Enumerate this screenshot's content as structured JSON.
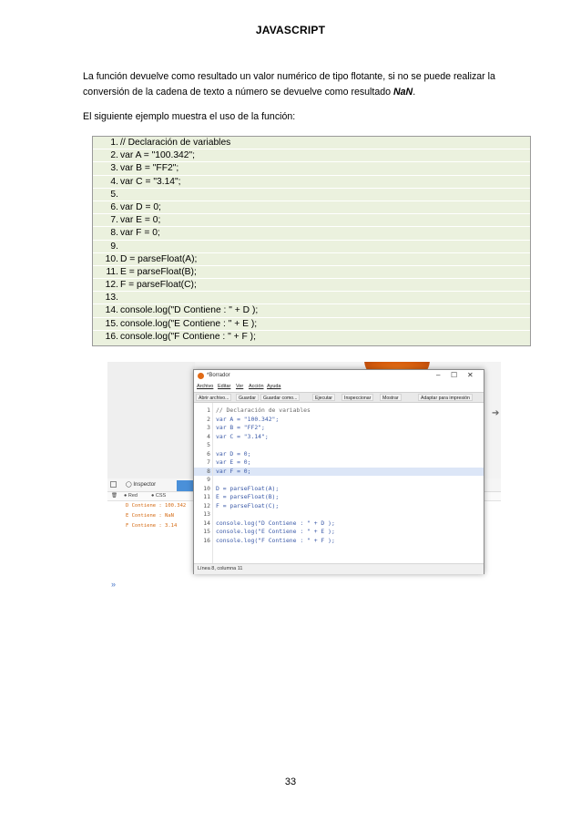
{
  "header": {
    "title": "JAVASCRIPT"
  },
  "paragraph1": {
    "line1": "La función devuelve como resultado un valor numérico de tipo flotante, si no se puede realizar la",
    "line2_before": "conversión de la cadena de texto a número se devuelve como resultado ",
    "line2_emphasis": "NaN",
    "line2_after": "."
  },
  "paragraph2": "El siguiente ejemplo muestra el uso de la función:",
  "code_listing": [
    {
      "num": "1.",
      "text": "// Declaración de variables"
    },
    {
      "num": "2.",
      "text": "var A = \"100.342\";"
    },
    {
      "num": "3.",
      "text": "var B = \"FF2\";"
    },
    {
      "num": "4.",
      "text": "var C = \"3.14\";"
    },
    {
      "num": "5.",
      "text": ""
    },
    {
      "num": "6.",
      "text": "var D = 0;"
    },
    {
      "num": "7.",
      "text": "var E = 0;"
    },
    {
      "num": "8.",
      "text": "var F = 0;"
    },
    {
      "num": "9.",
      "text": ""
    },
    {
      "num": "10.",
      "text": "D = parseFloat(A);"
    },
    {
      "num": "11.",
      "text": "E = parseFloat(B);"
    },
    {
      "num": "12.",
      "text": "F = parseFloat(C);"
    },
    {
      "num": "13.",
      "text": ""
    },
    {
      "num": "14.",
      "text": "console.log(\"D Contiene : \" + D );"
    },
    {
      "num": "15.",
      "text": "console.log(\"E Contiene : \" + E );"
    },
    {
      "num": "16.",
      "text": "console.log(\"F Contiene : \" + F );"
    }
  ],
  "screenshot": {
    "window_title": "*Borrador",
    "menu": [
      "Archivo",
      "Editar",
      "Ver",
      "Acción",
      "Ayuda"
    ],
    "toolbar": [
      "Abrir archivo...",
      "Guardar",
      "Guardar como...",
      "Ejecutar",
      "Inspeccionar",
      "Mostrar",
      "Adaptar para impresión"
    ],
    "editor_lines": [
      {
        "num": "1",
        "text": "// Declaración de variables"
      },
      {
        "num": "2",
        "text": "var A = \"100.342\";"
      },
      {
        "num": "3",
        "text": "var B = \"FF2\";"
      },
      {
        "num": "4",
        "text": "var C = \"3.14\";"
      },
      {
        "num": "5",
        "text": ""
      },
      {
        "num": "6",
        "text": "var D = 0;"
      },
      {
        "num": "7",
        "text": "var E = 0;"
      },
      {
        "num": "8",
        "text": "var F = 0;"
      },
      {
        "num": "9",
        "text": ""
      },
      {
        "num": "10",
        "text": "D = parseFloat(A);"
      },
      {
        "num": "11",
        "text": "E = parseFloat(B);"
      },
      {
        "num": "12",
        "text": "F = parseFloat(C);"
      },
      {
        "num": "13",
        "text": ""
      },
      {
        "num": "14",
        "text": "console.log(\"D Contiene : \" + D );"
      },
      {
        "num": "15",
        "text": "console.log(\"E Contiene : \" + E );"
      },
      {
        "num": "16",
        "text": "console.log(\"F Contiene : \" + F );"
      }
    ],
    "highlighted_line": "8",
    "status": "Línea 8, columna 11",
    "devtools_tab": "Inspector",
    "devtools_filter": "Red",
    "devtools_filter2": "CSS",
    "console_output": [
      "D Contiene : 100.342",
      "E Contiene : NaN",
      "F Contiene : 3.14"
    ]
  },
  "page_number": "33"
}
